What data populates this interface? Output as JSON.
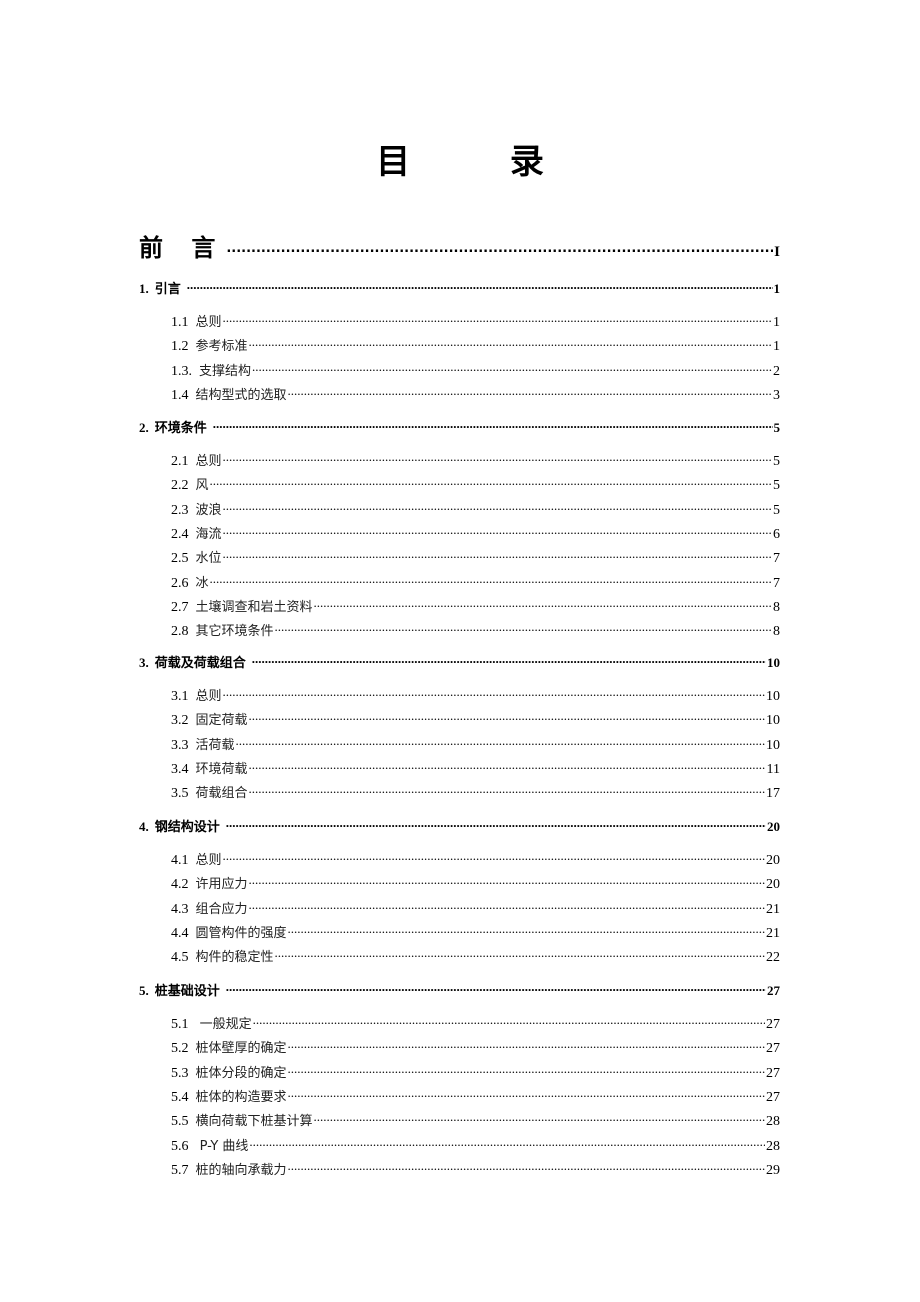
{
  "title": "目 录",
  "preface": {
    "label": "前 言",
    "page": "I"
  },
  "chapters": [
    {
      "num": "1.",
      "title": "引言",
      "page": "1",
      "sections": [
        {
          "num": "1.1",
          "title": "总则",
          "page": "1"
        },
        {
          "num": "1.2",
          "title": "参考标准",
          "page": "1"
        },
        {
          "num": "1.3.",
          "title": "支撑结构",
          "page": "2"
        },
        {
          "num": "1.4",
          "title": "结构型式的选取",
          "page": "3"
        }
      ]
    },
    {
      "num": "2.",
      "title": "环境条件",
      "page": "5",
      "sections": [
        {
          "num": "2.1",
          "title": "总则",
          "page": "5"
        },
        {
          "num": "2.2",
          "title": "风",
          "page": "5"
        },
        {
          "num": "2.3",
          "title": "波浪",
          "page": "5"
        },
        {
          "num": "2.4",
          "title": "海流",
          "page": "6"
        },
        {
          "num": "2.5",
          "title": "水位",
          "page": "7"
        },
        {
          "num": "2.6",
          "title": "冰",
          "page": "7"
        },
        {
          "num": "2.7",
          "title": "土壤调查和岩土资料",
          "page": "8"
        },
        {
          "num": "2.8",
          "title": "其它环境条件",
          "page": "8"
        }
      ]
    },
    {
      "num": "3.",
      "title": "荷载及荷载组合",
      "page": "10",
      "sections": [
        {
          "num": "3.1",
          "title": "总则",
          "page": "10"
        },
        {
          "num": "3.2",
          "title": "固定荷载",
          "page": "10"
        },
        {
          "num": "3.3",
          "title": "活荷载",
          "page": "10"
        },
        {
          "num": "3.4",
          "title": "环境荷载",
          "page": "11"
        },
        {
          "num": "3.5",
          "title": "荷载组合",
          "page": "17"
        }
      ]
    },
    {
      "num": "4.",
      "title": "钢结构设计",
      "page": "20",
      "sections": [
        {
          "num": "4.1",
          "title": "总则",
          "page": "20"
        },
        {
          "num": "4.2",
          "title": "许用应力",
          "page": "20"
        },
        {
          "num": "4.3",
          "title": "组合应力",
          "page": "21"
        },
        {
          "num": "4.4",
          "title": "圆管构件的强度",
          "page": "21"
        },
        {
          "num": "4.5",
          "title": "构件的稳定性",
          "page": "22"
        }
      ]
    },
    {
      "num": "5.",
      "title": "桩基础设计",
      "page": "27",
      "sections": [
        {
          "num": "5.1",
          "title": " 一般规定",
          "page": "27"
        },
        {
          "num": "5.2",
          "title": "桩体壁厚的确定",
          "page": "27"
        },
        {
          "num": "5.3",
          "title": "桩体分段的确定",
          "page": "27"
        },
        {
          "num": "5.4",
          "title": "桩体的构造要求",
          "page": "27"
        },
        {
          "num": "5.5",
          "title": "横向荷载下桩基计算",
          "page": "28"
        },
        {
          "num": "5.6",
          "title": " P-Y 曲线",
          "page": "28"
        },
        {
          "num": "5.7",
          "title": "桩的轴向承载力",
          "page": "29"
        }
      ]
    }
  ]
}
